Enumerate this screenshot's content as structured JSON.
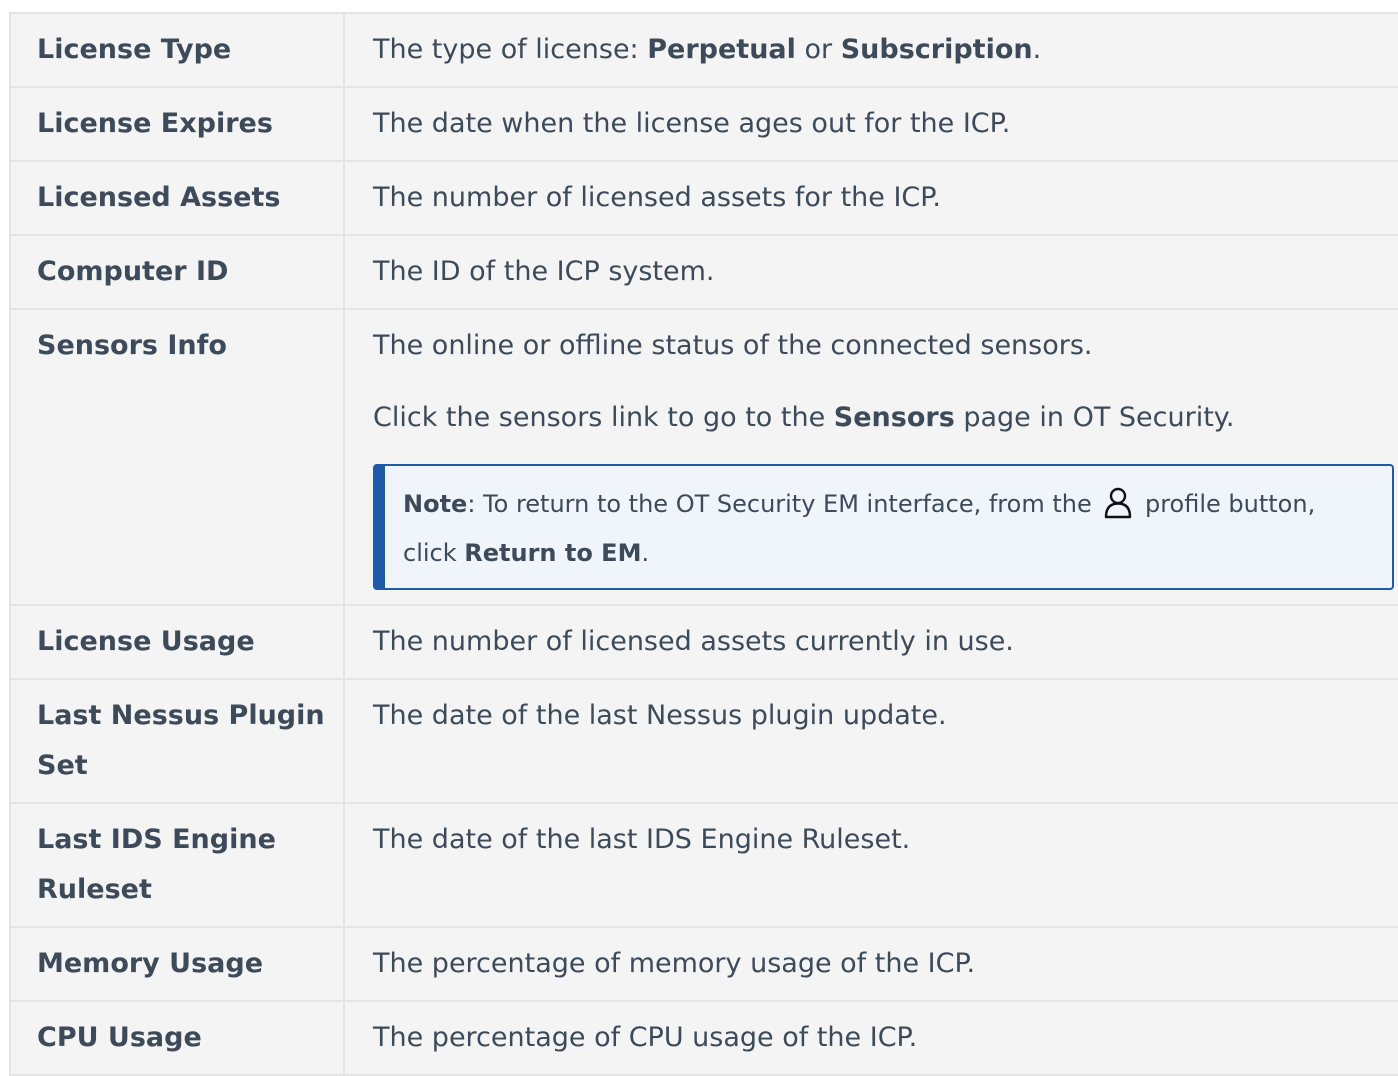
{
  "rows": [
    {
      "term": "License Type",
      "desc_prefix": "The type of license: ",
      "desc_bold1": "Perpetual",
      "desc_mid": " or ",
      "desc_bold2": "Subscription",
      "desc_suffix": "."
    },
    {
      "term": "License Expires",
      "desc": "The date when the license ages out for the ICP."
    },
    {
      "term": "Licensed Assets",
      "desc": "The number of licensed assets for the ICP."
    },
    {
      "term": "Computer ID",
      "desc": "The ID of the ICP system."
    },
    {
      "term": "Sensors Info",
      "desc": "The online or offline status of the connected sensors.",
      "desc2_prefix": "Click the sensors link to go to the ",
      "desc2_bold": "Sensors",
      "desc2_suffix": " page in OT Security.",
      "note": {
        "label": "Note",
        "text1": ": To return to the OT Security EM interface, from the ",
        "icon": "profile-icon",
        "text2": " profile button, click ",
        "bold": "Return to EM",
        "text3": "."
      }
    },
    {
      "term": "License Usage",
      "desc": "The number of licensed assets currently in use."
    },
    {
      "term": "Last Nessus Plugin Set",
      "desc": "The date of the last Nessus plugin update."
    },
    {
      "term": "Last IDS Engine Ruleset",
      "desc": "The date of the last IDS Engine Ruleset."
    },
    {
      "term": "Memory Usage",
      "desc": "The percentage of memory usage of the ICP."
    },
    {
      "term": "CPU Usage",
      "desc": "The percentage of CPU usage of the ICP."
    }
  ]
}
